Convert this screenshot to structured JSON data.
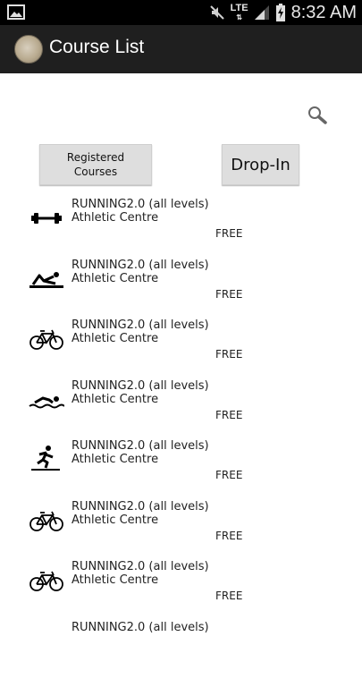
{
  "status_bar": {
    "network": "LTE",
    "time": "8:32 AM",
    "icons": [
      "gallery-icon",
      "mute-icon",
      "signal-icon",
      "battery-charging-icon"
    ]
  },
  "action_bar": {
    "title": "Course List",
    "icon": "app-logo-icon"
  },
  "search": {
    "icon": "search-icon"
  },
  "buttons": {
    "registered_line1": "Registered",
    "registered_line2": "Courses",
    "dropin": "Drop-In"
  },
  "courses": [
    {
      "name": "RUNNING2.0 (all levels)",
      "location": "Athletic Centre",
      "price": "FREE",
      "icon": "dumbbell-icon"
    },
    {
      "name": "RUNNING2.0 (all levels)",
      "location": "Athletic Centre",
      "price": "FREE",
      "icon": "situps-icon"
    },
    {
      "name": "RUNNING2.0 (all levels)",
      "location": "Athletic Centre",
      "price": "FREE",
      "icon": "bicycle-icon"
    },
    {
      "name": "RUNNING2.0 (all levels)",
      "location": "Athletic Centre",
      "price": "FREE",
      "icon": "swimming-icon"
    },
    {
      "name": "RUNNING2.0 (all levels)",
      "location": "Athletic Centre",
      "price": "FREE",
      "icon": "treadmill-icon"
    },
    {
      "name": "RUNNING2.0 (all levels)",
      "location": "Athletic Centre",
      "price": "FREE",
      "icon": "bicycle-icon"
    },
    {
      "name": "RUNNING2.0 (all levels)",
      "location": "Athletic Centre",
      "price": "FREE",
      "icon": "bicycle-icon"
    },
    {
      "name": "RUNNING2.0 (all levels)",
      "location": "",
      "price": "",
      "icon": ""
    }
  ]
}
